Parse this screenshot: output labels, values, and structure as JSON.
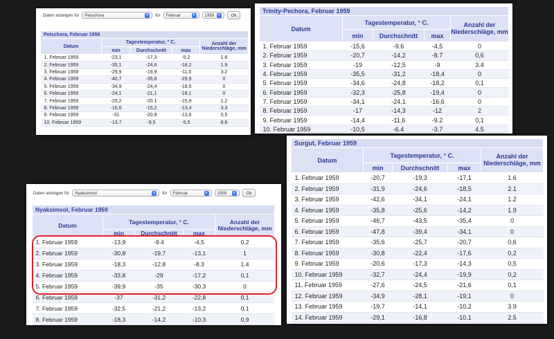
{
  "colors": {
    "background": "#1b1b1d",
    "caption_bg": "#d8dcf2",
    "header_bg": "#dde1f5",
    "header_text": "#2d3b8f",
    "highlight": "#e0202a"
  },
  "headers": {
    "datum": "Datum",
    "tagestemp": "Tagestemperatur, ° C.",
    "min": "min",
    "durchschnitt": "Durchschnitt",
    "max": "max",
    "niederschlag": "Anzahl der Niederschläge, mm"
  },
  "panels": [
    {
      "id": "petschora",
      "form": {
        "label": "Daten anzeigen für",
        "station": "Petschora",
        "fuer": "für",
        "month": "Februar",
        "year": "1959",
        "ok": "Ok"
      },
      "caption": "Petschora, Februar 1959",
      "rows": [
        [
          "1. Februar 1959",
          "-23,1",
          "-17,3",
          "-5.2",
          "1.8"
        ],
        [
          "2. Februar 1959",
          "-35,1",
          "-24,6",
          "-18,2",
          "1.9"
        ],
        [
          "3. Februar 1959",
          "-29,9",
          "-19,9",
          "-11,5",
          "3.2"
        ],
        [
          "4. Februar 1959",
          "-40,7",
          "-35,8",
          "-29,9",
          "0"
        ],
        [
          "5. Februar 1959",
          "-34,9",
          "-24,4",
          "-18,5",
          "0"
        ],
        [
          "6. Februar 1959",
          "-24,1",
          "-21,1",
          "-18,1",
          "0"
        ],
        [
          "7. Februar 1959",
          "-25,2",
          "-20.1",
          "-15,9",
          "1.2"
        ],
        [
          "8. Februar 1959",
          "-16,6",
          "-15,2",
          "-13,4",
          "3.3"
        ],
        [
          "9. Februar 1959",
          "-31",
          "-20,9",
          "-13,6",
          "0,5"
        ],
        [
          "10. Februar 1959",
          "-13,7",
          "-9,5",
          "-5,5",
          "6.6"
        ]
      ]
    },
    {
      "id": "trinity",
      "caption": "Trinity-Pechora, Februar 1959",
      "rows": [
        [
          "1. Februar 1959",
          "-15,6",
          "-9.6",
          "-4,5",
          "0"
        ],
        [
          "2. Februar 1959",
          "-20,7",
          "-14,2",
          "-8.7",
          "0,6"
        ],
        [
          "3. Februar 1959",
          "-19",
          "-12,5",
          "-9",
          "3.4"
        ],
        [
          "4. Februar 1959",
          "-35,5",
          "-31,2",
          "-18,4",
          "0"
        ],
        [
          "5. Februar 1959",
          "-34,6",
          "-24,8",
          "-18,2",
          "0,1"
        ],
        [
          "6. Februar 1959",
          "-32,3",
          "-25,8",
          "-19,4",
          "0"
        ],
        [
          "7. Februar 1959",
          "-34,1",
          "-24,1",
          "-16,6",
          "0"
        ],
        [
          "8. Februar 1959",
          "-17",
          "-14,3",
          "-12",
          "2"
        ],
        [
          "9. Februar 1959",
          "-14,4",
          "-11,6",
          "-9.2",
          "0,1"
        ],
        [
          "10. Februar 1959",
          "-10,5",
          "-6.4",
          "-3.7",
          "4.5"
        ]
      ]
    },
    {
      "id": "nyaksimvol",
      "form": {
        "label": "Daten anzeigen für",
        "station": "Nyaksimvol",
        "fuer": "für",
        "month": "Februar",
        "year": "1959",
        "ok": "Ok"
      },
      "caption": "Nyaksimvol, Februar 1959",
      "rows": [
        [
          "1. Februar 1959",
          "-13,9",
          "-9.4",
          "-4,5",
          "0,2"
        ],
        [
          "2. Februar 1959",
          "-30,8",
          "-19,7",
          "-13,1",
          "1"
        ],
        [
          "3. Februar 1959",
          "-18,3",
          "-12,8",
          "-8.3",
          "1.4"
        ],
        [
          "4. Februar 1959",
          "-33,8",
          "-29",
          "-17,2",
          "0,1"
        ],
        [
          "5. Februar 1959",
          "-39,9",
          "-35",
          "-30,3",
          "0"
        ],
        [
          "6. Februar 1959",
          "-37",
          "-31,2",
          "-22,8",
          "0,1"
        ],
        [
          "7. Februar 1959",
          "-32,5",
          "-21,2",
          "-13,2",
          "0,1"
        ],
        [
          "8. Februar 1959",
          "-18,3",
          "-14,2",
          "-10,3",
          "0,9"
        ]
      ]
    },
    {
      "id": "surgut",
      "caption": "Surgut, Februar 1959",
      "rows": [
        [
          "1. Februar 1959",
          "-20,7",
          "-19,3",
          "-17,1",
          "1.6"
        ],
        [
          "2. Februar 1959",
          "-31,9",
          "-24,6",
          "-18,5",
          "2.1"
        ],
        [
          "3. Februar 1959",
          "-42,6",
          "-34,1",
          "-24,1",
          "1.2"
        ],
        [
          "4. Februar 1959",
          "-35,8",
          "-25,6",
          "-14,2",
          "1.9"
        ],
        [
          "5. Februar 1959",
          "-46,7",
          "-43,5",
          "-35,4",
          "0"
        ],
        [
          "6. Februar 1959",
          "-47,8",
          "-39,4",
          "-34,1",
          "0"
        ],
        [
          "7. Februar 1959",
          "-35,6",
          "-25,7",
          "-20,7",
          "0,6"
        ],
        [
          "8. Februar 1959",
          "-30,8",
          "-22,4",
          "-17,6",
          "0,2"
        ],
        [
          "9. Februar 1959",
          "-20,6",
          "-17,3",
          "-14,3",
          "0,5"
        ],
        [
          "10. Februar 1959",
          "-32,7",
          "-24,4",
          "-19,9",
          "0,2"
        ],
        [
          "11. Februar 1959",
          "-27,6",
          "-24,5",
          "-21,6",
          "0,1"
        ],
        [
          "12. Februar 1959",
          "-34,9",
          "-28,1",
          "-19,1",
          "0"
        ],
        [
          "13. Februar 1959",
          "-19,7",
          "-14,1",
          "-10,2",
          "3.9"
        ],
        [
          "14. Februar 1959",
          "-29,1",
          "-16,8",
          "-10.1",
          "2.5"
        ]
      ]
    }
  ]
}
